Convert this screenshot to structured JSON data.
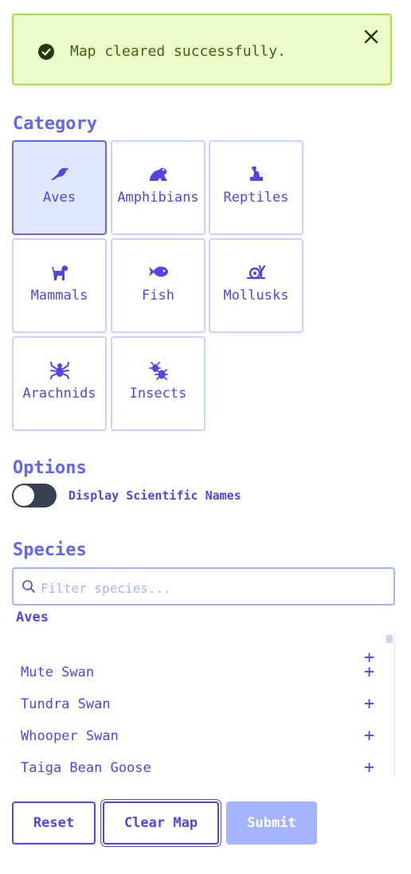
{
  "alert": {
    "message": "Map cleared successfully.",
    "icon": "check-circle-icon",
    "close_icon": "close-icon"
  },
  "category": {
    "heading": "Category",
    "tiles": [
      {
        "label": "Aves",
        "icon": "bird-icon",
        "selected": true
      },
      {
        "label": "Amphibians",
        "icon": "frog-icon",
        "selected": false
      },
      {
        "label": "Reptiles",
        "icon": "reptile-icon",
        "selected": false
      },
      {
        "label": "Mammals",
        "icon": "dog-icon",
        "selected": false
      },
      {
        "label": "Fish",
        "icon": "fish-icon",
        "selected": false
      },
      {
        "label": "Mollusks",
        "icon": "snail-icon",
        "selected": false
      },
      {
        "label": "Arachnids",
        "icon": "spider-icon",
        "selected": false
      },
      {
        "label": "Insects",
        "icon": "bug-icon",
        "selected": false
      }
    ]
  },
  "options": {
    "heading": "Options",
    "toggle_label": "Display Scientific Names",
    "toggle_on": false
  },
  "species": {
    "heading": "Species",
    "search_placeholder": "Filter species...",
    "group": "Aves",
    "items": [
      "Mute Swan",
      "Tundra Swan",
      "Whooper Swan",
      "Taiga Bean Goose"
    ],
    "add_symbol": "+"
  },
  "buttons": {
    "reset": "Reset",
    "clear": "Clear Map",
    "submit": "Submit"
  },
  "colors": {
    "accent": "#6366f1",
    "success_bg": "#ecfccb",
    "success_border": "#a3e635",
    "disabled": "#a5b4fc"
  }
}
